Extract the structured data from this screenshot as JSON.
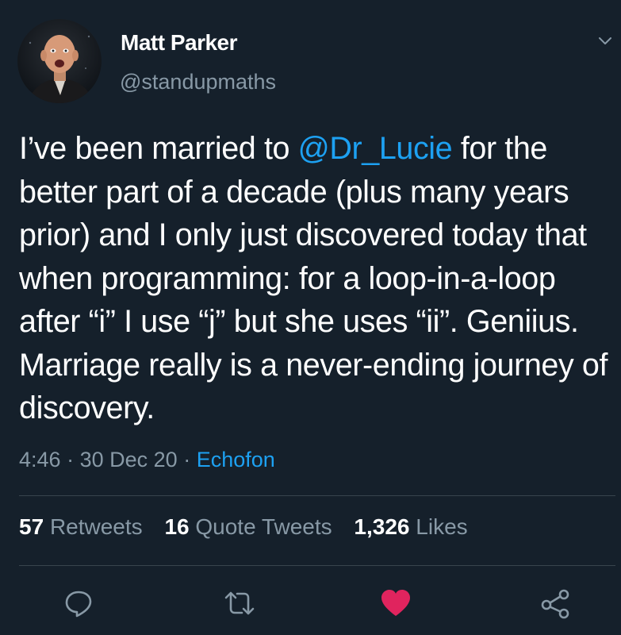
{
  "author": {
    "name": "Matt Parker",
    "handle": "@standupmaths"
  },
  "tweet": {
    "text_before_mention": "I’ve been married to ",
    "mention": "@Dr_Lucie",
    "text_after_mention": " for the better part of a decade (plus many years prior) and I only just discovered today that when programming: for a loop-in-a-loop after “i” I use “j” but she uses “ii”. Geniius. Marriage really is a never-ending journey of discovery.",
    "time": "4:46",
    "separator": "·",
    "date": "30 Dec 20",
    "source": "Echofon"
  },
  "stats": {
    "retweets_count": "57",
    "retweets_label": "Retweets",
    "quote_count": "16",
    "quote_label": "Quote Tweets",
    "likes_count": "1,326",
    "likes_label": "Likes"
  },
  "icons": {
    "caret": "chevron-down-icon",
    "reply": "reply-icon",
    "retweet": "retweet-icon",
    "like": "heart-icon",
    "share": "share-icon"
  },
  "colors": {
    "background": "#15202b",
    "link": "#1da1f2",
    "secondary_text": "#8899a6",
    "like_active": "#e0245e",
    "divider": "#38444d"
  }
}
